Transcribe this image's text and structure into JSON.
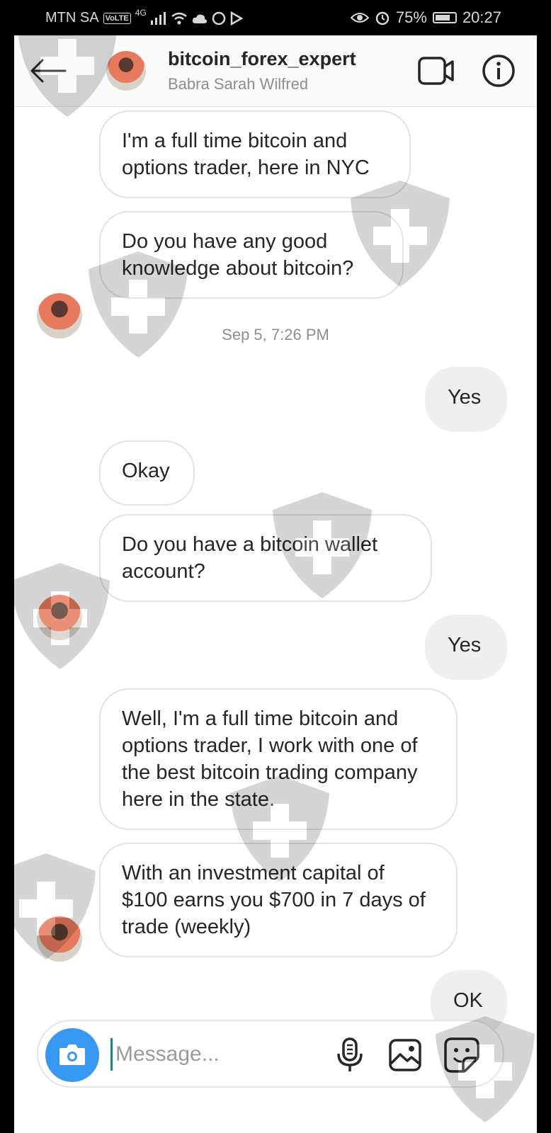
{
  "status_bar": {
    "carrier": "MTN SA",
    "volte": "VoLTE",
    "network": "4G",
    "battery": "75%",
    "time": "20:27",
    "battery_level": 0.75
  },
  "header": {
    "username": "bitcoin_forex_expert",
    "full_name": "Babra Sarah Wilfred",
    "back_icon": "arrow-left-icon",
    "video_icon": "video-camera-icon",
    "info_icon": "info-circle-icon"
  },
  "messages": [
    {
      "direction": "in",
      "text": "I'm a full time bitcoin and options trader, here in NYC"
    },
    {
      "direction": "in",
      "text": "Do you have any good knowledge about bitcoin?"
    },
    {
      "type": "timestamp",
      "text": "Sep 5, 7:26 PM"
    },
    {
      "direction": "out",
      "text": "Yes"
    },
    {
      "direction": "in",
      "text": "Okay"
    },
    {
      "direction": "in",
      "text": "Do you have a bitcoin wallet account?"
    },
    {
      "direction": "out",
      "text": "Yes"
    },
    {
      "direction": "in",
      "text": "Well, I'm a full time bitcoin and options trader,  I work with one of the best bitcoin trading company here in the state."
    },
    {
      "direction": "in",
      "text": "With an investment capital of $100 earns you $700 in 7 days of trade (weekly)"
    },
    {
      "direction": "out",
      "text": "OK"
    }
  ],
  "composer": {
    "placeholder": "Message...",
    "camera_icon": "camera-icon",
    "mic_icon": "microphone-icon",
    "gallery_icon": "gallery-icon",
    "sticker_icon": "sticker-icon"
  },
  "colors": {
    "accent": "#3897f0",
    "outgoing_bubble": "#efefef",
    "incoming_border": "#e2e2e2"
  }
}
